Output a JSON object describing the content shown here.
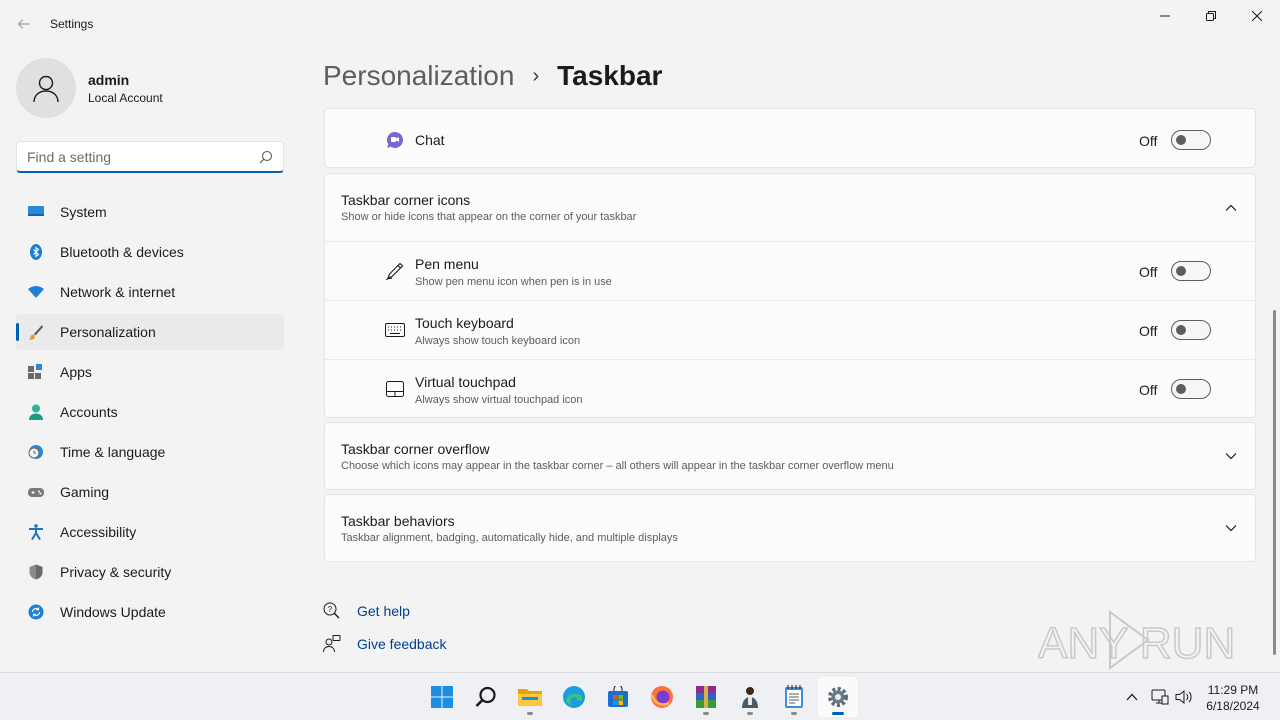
{
  "window": {
    "title": "Settings"
  },
  "user": {
    "name": "admin",
    "account_type": "Local Account"
  },
  "search": {
    "placeholder": "Find a setting",
    "value": ""
  },
  "sidebar": {
    "items": [
      {
        "label": "System",
        "icon": "system-icon"
      },
      {
        "label": "Bluetooth & devices",
        "icon": "bluetooth-icon"
      },
      {
        "label": "Network & internet",
        "icon": "wifi-icon"
      },
      {
        "label": "Personalization",
        "icon": "brush-icon",
        "selected": true
      },
      {
        "label": "Apps",
        "icon": "apps-icon"
      },
      {
        "label": "Accounts",
        "icon": "person-icon"
      },
      {
        "label": "Time & language",
        "icon": "clock-globe-icon"
      },
      {
        "label": "Gaming",
        "icon": "gamepad-icon"
      },
      {
        "label": "Accessibility",
        "icon": "accessibility-icon"
      },
      {
        "label": "Privacy & security",
        "icon": "shield-icon"
      },
      {
        "label": "Windows Update",
        "icon": "update-icon"
      }
    ]
  },
  "breadcrumb": {
    "parent": "Personalization",
    "separator": "›",
    "current": "Taskbar"
  },
  "chat_row": {
    "label": "Chat",
    "state": "Off",
    "on": false
  },
  "corner_icons": {
    "title": "Taskbar corner icons",
    "subtitle": "Show or hide icons that appear on the corner of your taskbar",
    "expanded": true,
    "items": [
      {
        "title": "Pen menu",
        "subtitle": "Show pen menu icon when pen is in use",
        "state": "Off",
        "on": false
      },
      {
        "title": "Touch keyboard",
        "subtitle": "Always show touch keyboard icon",
        "state": "Off",
        "on": false
      },
      {
        "title": "Virtual touchpad",
        "subtitle": "Always show virtual touchpad icon",
        "state": "Off",
        "on": false
      }
    ]
  },
  "corner_overflow": {
    "title": "Taskbar corner overflow",
    "subtitle": "Choose which icons may appear in the taskbar corner – all others will appear in the taskbar corner overflow menu"
  },
  "behaviors": {
    "title": "Taskbar behaviors",
    "subtitle": "Taskbar alignment, badging, automatically hide, and multiple displays"
  },
  "help": {
    "get_help": "Get help",
    "give_feedback": "Give feedback"
  },
  "watermark": {
    "text": "ANY RUN"
  },
  "taskbar": {
    "apps": [
      "start-icon",
      "search-icon",
      "file-explorer-icon",
      "edge-icon",
      "store-icon",
      "firefox-icon",
      "winrar-icon",
      "user-app-icon",
      "notepad-icon",
      "settings-icon"
    ],
    "time": "11:29 PM",
    "date": "6/18/2024"
  },
  "colors": {
    "accent": "#005fb8",
    "link": "#003e92",
    "background": "#f3f3f3",
    "card": "#fbfbfb"
  }
}
